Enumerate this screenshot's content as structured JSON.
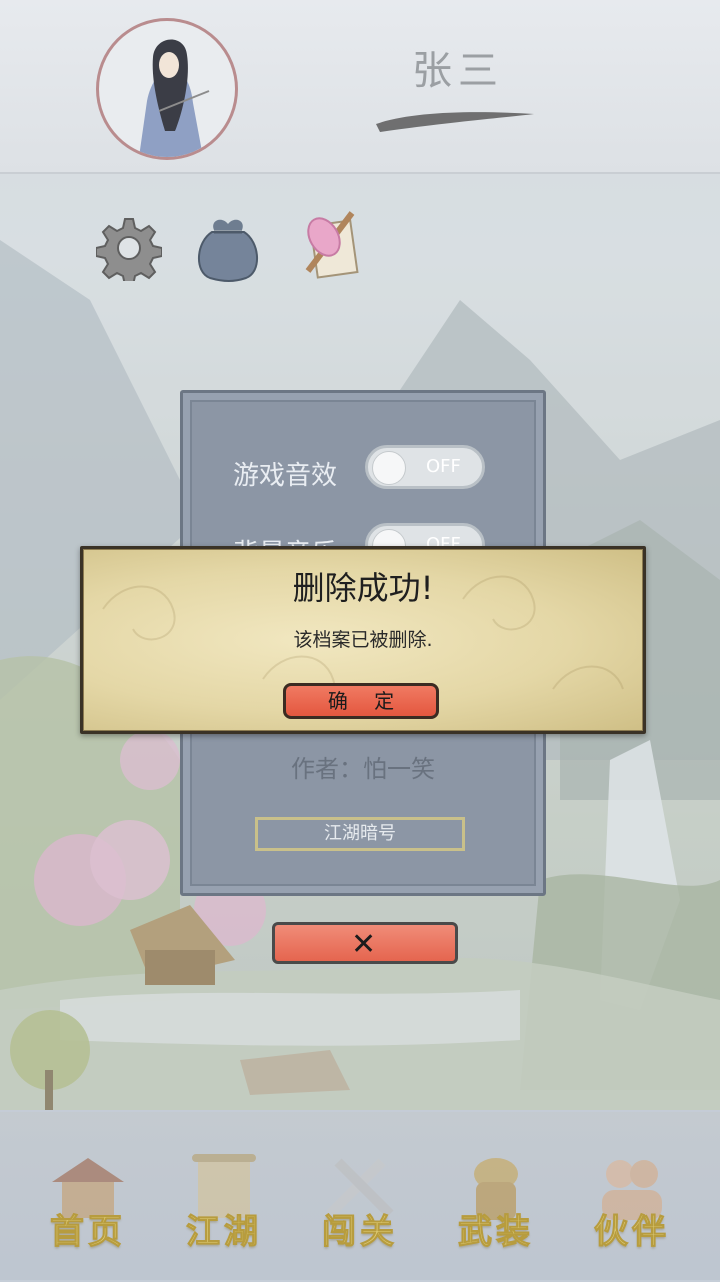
{
  "player": {
    "name": "张三"
  },
  "top_icons": [
    "gear-icon",
    "bag-icon",
    "scroll-icon"
  ],
  "settings_panel": {
    "rows": [
      {
        "label": "游戏音效",
        "toggle": "OFF"
      },
      {
        "label": "背景音乐",
        "toggle": "OFF"
      }
    ],
    "author": "作者：怕一笑",
    "code_button": "江湖暗号",
    "close_icon": "close-x-icon"
  },
  "dialog": {
    "title": "删除成功!",
    "message": "该档案已被删除.",
    "ok_button": "确 定"
  },
  "nav": {
    "items": [
      {
        "label": "首页",
        "icon": "house-icon"
      },
      {
        "label": "江湖",
        "icon": "map-scroll-icon"
      },
      {
        "label": "闯关",
        "icon": "swords-icon"
      },
      {
        "label": "武装",
        "icon": "armor-icon"
      },
      {
        "label": "伙伴",
        "icon": "partners-icon"
      }
    ]
  },
  "colors": {
    "dialog_button": "#e4573f",
    "panel": "#8c96a5",
    "nav_text": "#e0cf7a"
  }
}
